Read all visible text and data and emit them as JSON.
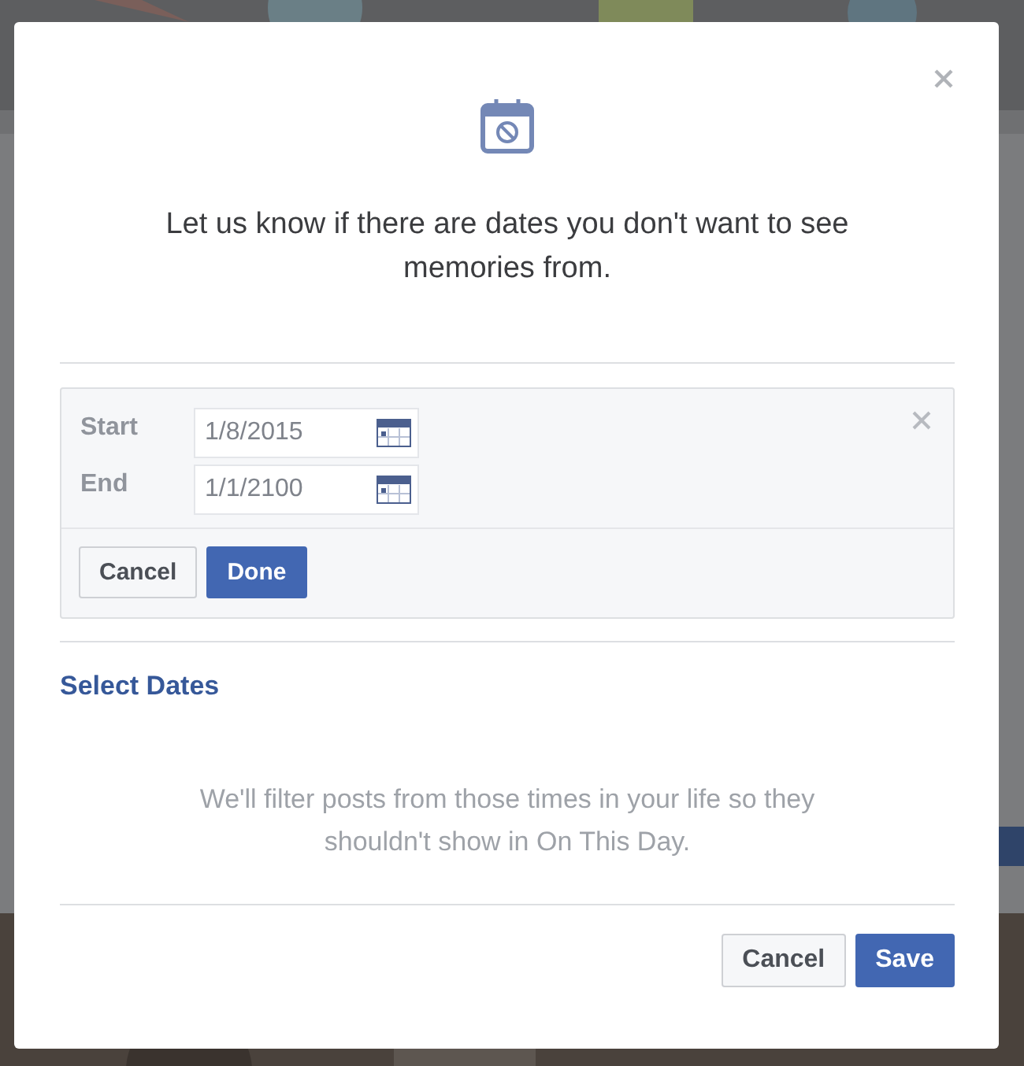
{
  "dialog": {
    "heading": "Let us know if there are dates you don't want to see memories from.",
    "date_range": {
      "fields": [
        {
          "label": "Start",
          "value": "1/8/2015"
        },
        {
          "label": "End",
          "value": "1/1/2100"
        }
      ],
      "buttons": [
        {
          "label": "Cancel",
          "kind": "secondary"
        },
        {
          "label": "Done",
          "kind": "primary"
        }
      ]
    },
    "link": "Select Dates",
    "description": "We'll filter posts from those times in your life so they shouldn't show in On This Day.",
    "buttons": [
      {
        "label": "Cancel",
        "kind": "secondary"
      },
      {
        "label": "Save",
        "kind": "primary"
      }
    ]
  }
}
